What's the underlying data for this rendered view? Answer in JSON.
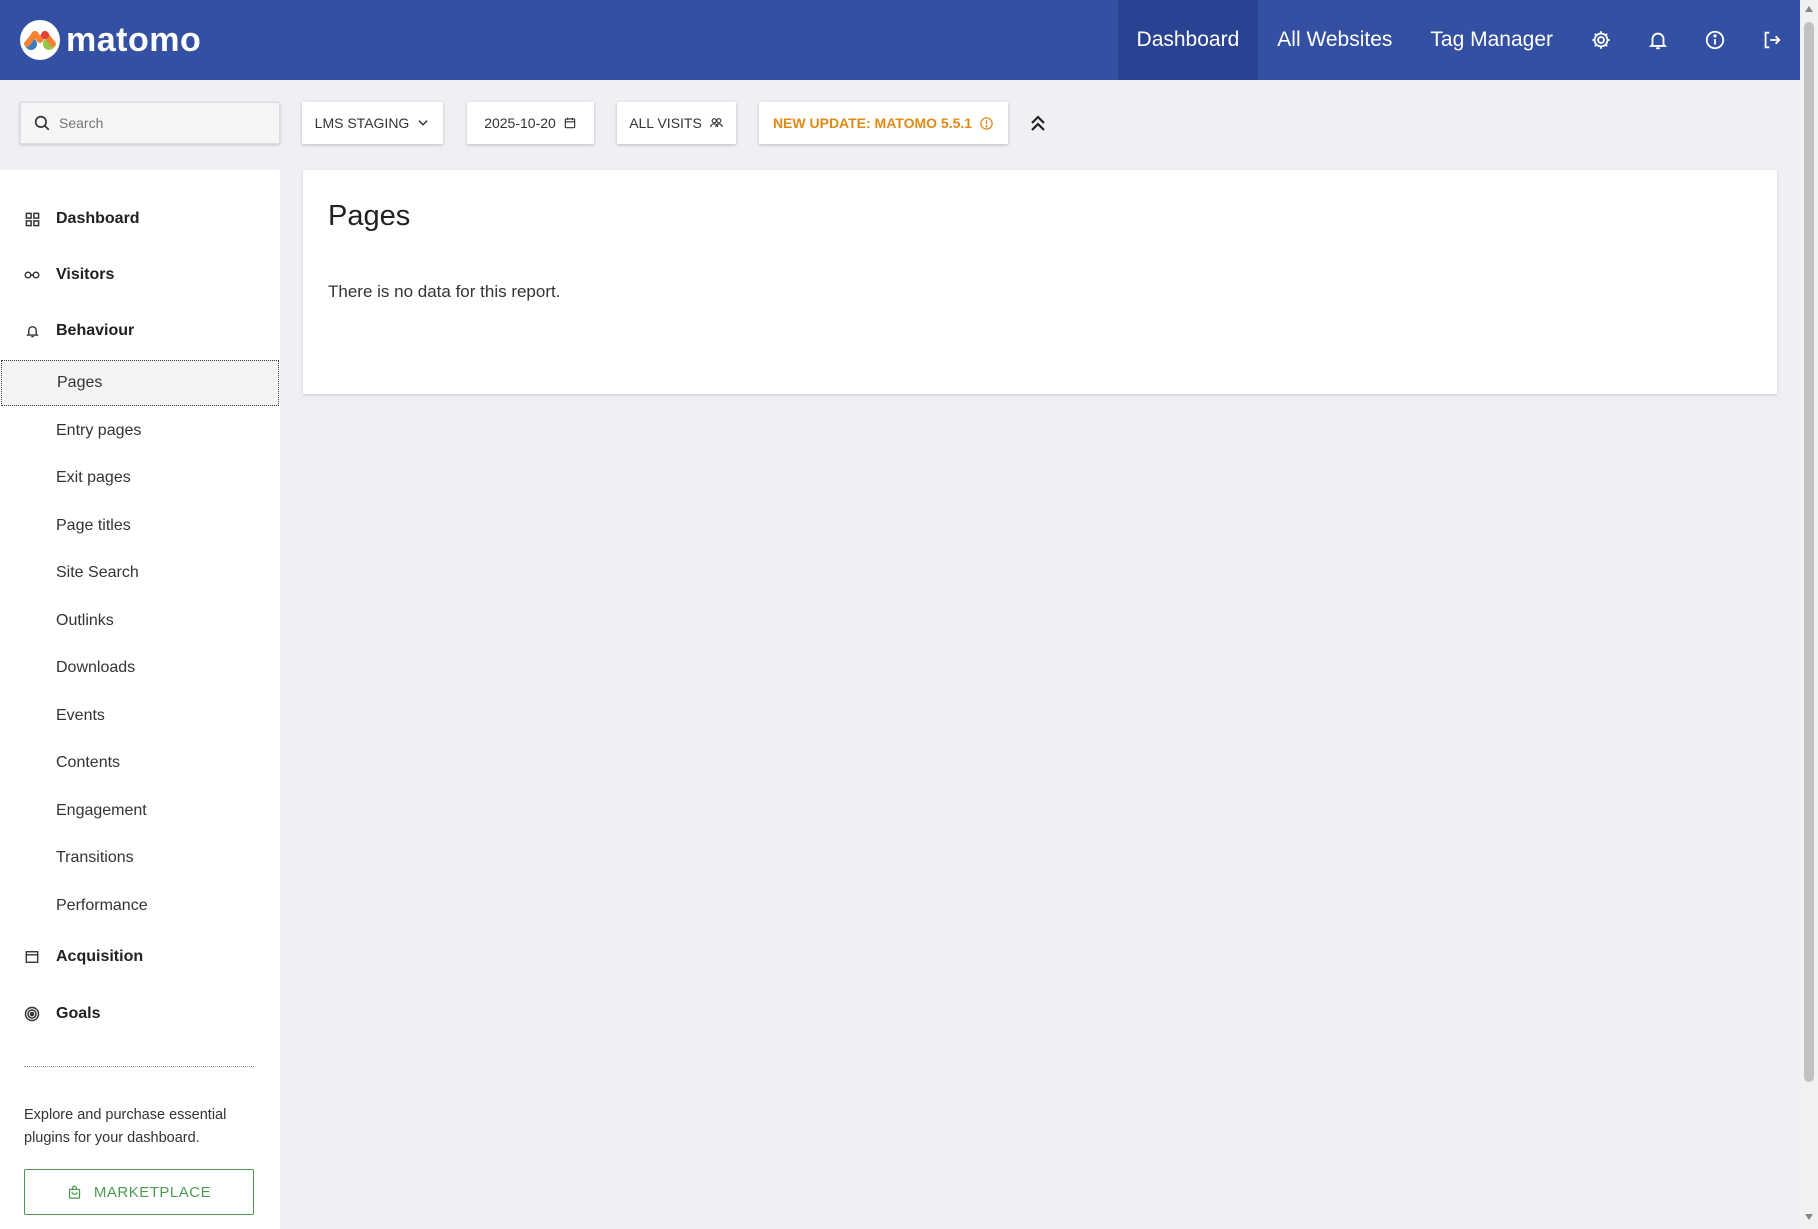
{
  "app": {
    "logo_text": "matomo"
  },
  "topnav": {
    "links": [
      {
        "label": "Dashboard",
        "active": true
      },
      {
        "label": "All Websites",
        "active": false
      },
      {
        "label": "Tag Manager",
        "active": false
      }
    ],
    "icons": [
      "gear-icon",
      "bell-icon",
      "info-icon",
      "logout-icon"
    ]
  },
  "toolbar": {
    "search_placeholder": "Search",
    "site_selector": "LMS STAGING",
    "date": "2025-10-20",
    "segment": "ALL VISITS",
    "update_notice": "NEW UPDATE: MATOMO 5.5.1"
  },
  "sidebar": {
    "categories": [
      {
        "label": "Dashboard",
        "icon": "grid-icon"
      },
      {
        "label": "Visitors",
        "icon": "glasses-icon"
      },
      {
        "label": "Behaviour",
        "icon": "bell-icon"
      },
      {
        "label": "Acquisition",
        "icon": "browser-window-icon"
      },
      {
        "label": "Goals",
        "icon": "target-icon"
      }
    ],
    "behaviour_items": [
      "Pages",
      "Entry pages",
      "Exit pages",
      "Page titles",
      "Site Search",
      "Outlinks",
      "Downloads",
      "Events",
      "Contents",
      "Engagement",
      "Transitions",
      "Performance"
    ],
    "active_item": "Pages",
    "promo_text": "Explore and purchase essential plugins for your dashboard.",
    "marketplace_label": "MARKETPLACE"
  },
  "report": {
    "title": "Pages",
    "message": "There is no data for this report."
  },
  "colors": {
    "topnav_bg": "#3450a3",
    "topnav_active_bg": "#2a4292",
    "page_bg": "#eef0f3",
    "update_accent": "#e08a16",
    "marketplace_green": "#4c9a52"
  }
}
